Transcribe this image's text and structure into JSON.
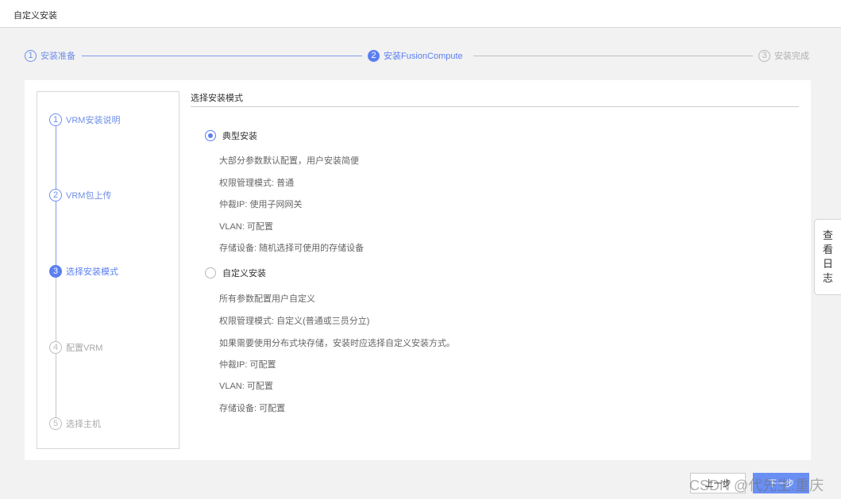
{
  "window": {
    "title": "自定义安装"
  },
  "stepper": [
    {
      "num": "1",
      "label": "安装准备",
      "state": "done"
    },
    {
      "num": "2",
      "label": "安装FusionCompute",
      "state": "active"
    },
    {
      "num": "3",
      "label": "安装完成",
      "state": "pending"
    }
  ],
  "substeps": [
    {
      "num": "1",
      "label": "VRM安装说明",
      "state": "done"
    },
    {
      "num": "2",
      "label": "VRM包上传",
      "state": "done"
    },
    {
      "num": "3",
      "label": "选择安装模式",
      "state": "active"
    },
    {
      "num": "4",
      "label": "配置VRM",
      "state": "pending"
    },
    {
      "num": "5",
      "label": "选择主机",
      "state": "pending"
    }
  ],
  "main": {
    "section_title": "选择安装模式",
    "options": [
      {
        "label": "典型安装",
        "selected": true,
        "details": [
          "大部分参数默认配置，用户安装简便",
          "权限管理模式: 普通",
          "仲裁IP: 使用子网网关",
          "VLAN: 可配置",
          "存储设备: 随机选择可使用的存储设备"
        ]
      },
      {
        "label": "自定义安装",
        "selected": false,
        "details": [
          "所有参数配置用户自定义",
          "权限管理模式: 自定义(普通或三员分立)",
          "如果需要使用分布式块存储，安装时应选择自定义安装方式。",
          "仲裁IP: 可配置",
          "VLAN: 可配置",
          "存储设备: 可配置"
        ]
      }
    ]
  },
  "log_tab": [
    "查",
    "看",
    "日",
    "志"
  ],
  "footer": {
    "prev_label": "上一步",
    "next_label": "下一步"
  },
  "watermark": "CSDN @代先生.重庆",
  "colors": {
    "accent": "#5b7ff0",
    "link": "#6f8fe8",
    "pending": "#b7b7b7"
  }
}
